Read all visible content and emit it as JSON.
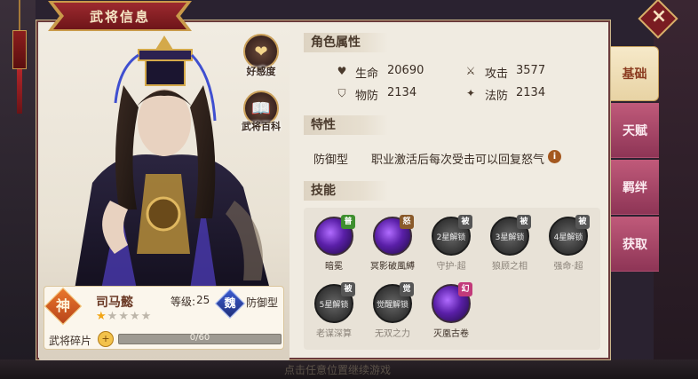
{
  "window": {
    "title": "武将信息",
    "close_label": "×"
  },
  "portrait": {
    "affection_label": "好感度",
    "encyclopedia_label": "武将百科",
    "affection_icon": "heart-icon",
    "encyclopedia_icon": "book-icon"
  },
  "hero": {
    "rarity": "神",
    "name": "司马懿",
    "level_label": "等级:",
    "level": "25",
    "faction": "魏",
    "class": "防御型",
    "stars_filled": 1,
    "stars_total": 5,
    "fragments_label": "武将碎片",
    "fragments_text": "0/60",
    "fragments_progress": 0
  },
  "attributes": {
    "header": "角色属性",
    "stats": [
      {
        "icon": "heart-icon",
        "label": "生命",
        "value": "20690"
      },
      {
        "icon": "sword-icon",
        "label": "攻击",
        "value": "3577"
      },
      {
        "icon": "shield-icon",
        "label": "物防",
        "value": "2134"
      },
      {
        "icon": "magic-shield-icon",
        "label": "法防",
        "value": "2134"
      }
    ]
  },
  "trait": {
    "header": "特性",
    "name": "防御型",
    "description": "职业激活后每次受击可以回复怒气",
    "info_label": "i"
  },
  "skills": {
    "header": "技能",
    "items": [
      {
        "name": "暗冕",
        "tag": "普",
        "tag_color": "#3e8f2e",
        "locked": false,
        "lock_text": ""
      },
      {
        "name": "冥影破風縛",
        "tag": "怒",
        "tag_color": "#8a5a2a",
        "locked": false,
        "lock_text": ""
      },
      {
        "name": "守护·超",
        "tag": "被",
        "tag_color": "#555555",
        "locked": true,
        "lock_text": "2星解锁"
      },
      {
        "name": "狼顾之相",
        "tag": "被",
        "tag_color": "#555555",
        "locked": true,
        "lock_text": "3星解锁"
      },
      {
        "name": "强命·超",
        "tag": "被",
        "tag_color": "#555555",
        "locked": true,
        "lock_text": "4星解锁"
      },
      {
        "name": "老谋深算",
        "tag": "被",
        "tag_color": "#555555",
        "locked": true,
        "lock_text": "5星解锁"
      },
      {
        "name": "无双之力",
        "tag": "觉",
        "tag_color": "#555555",
        "locked": true,
        "lock_text": "觉醒解锁"
      },
      {
        "name": "灭凰古卷",
        "tag": "幻",
        "tag_color": "#c23a7a",
        "locked": false,
        "lock_text": ""
      }
    ]
  },
  "tabs": [
    {
      "label": "基础",
      "active": true
    },
    {
      "label": "天赋",
      "active": false
    },
    {
      "label": "羁绊",
      "active": false
    },
    {
      "label": "获取",
      "active": false
    }
  ],
  "footer_hint": "点击任意位置继续游戏",
  "colors": {
    "accent_red": "#9d2a2f",
    "gold": "#c99a4a",
    "tab_pink": "#c05a7a",
    "star": "#f2a516"
  }
}
